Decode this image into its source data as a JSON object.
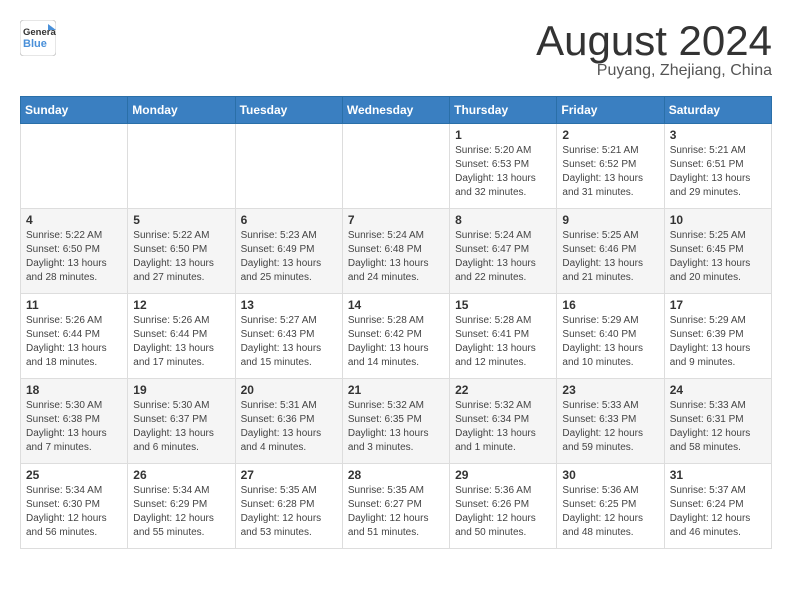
{
  "logo": {
    "line1": "General",
    "line2": "Blue"
  },
  "title": "August 2024",
  "location": "Puyang, Zhejiang, China",
  "weekdays": [
    "Sunday",
    "Monday",
    "Tuesday",
    "Wednesday",
    "Thursday",
    "Friday",
    "Saturday"
  ],
  "weeks": [
    [
      {
        "day": "",
        "info": ""
      },
      {
        "day": "",
        "info": ""
      },
      {
        "day": "",
        "info": ""
      },
      {
        "day": "",
        "info": ""
      },
      {
        "day": "1",
        "info": "Sunrise: 5:20 AM\nSunset: 6:53 PM\nDaylight: 13 hours\nand 32 minutes."
      },
      {
        "day": "2",
        "info": "Sunrise: 5:21 AM\nSunset: 6:52 PM\nDaylight: 13 hours\nand 31 minutes."
      },
      {
        "day": "3",
        "info": "Sunrise: 5:21 AM\nSunset: 6:51 PM\nDaylight: 13 hours\nand 29 minutes."
      }
    ],
    [
      {
        "day": "4",
        "info": "Sunrise: 5:22 AM\nSunset: 6:50 PM\nDaylight: 13 hours\nand 28 minutes."
      },
      {
        "day": "5",
        "info": "Sunrise: 5:22 AM\nSunset: 6:50 PM\nDaylight: 13 hours\nand 27 minutes."
      },
      {
        "day": "6",
        "info": "Sunrise: 5:23 AM\nSunset: 6:49 PM\nDaylight: 13 hours\nand 25 minutes."
      },
      {
        "day": "7",
        "info": "Sunrise: 5:24 AM\nSunset: 6:48 PM\nDaylight: 13 hours\nand 24 minutes."
      },
      {
        "day": "8",
        "info": "Sunrise: 5:24 AM\nSunset: 6:47 PM\nDaylight: 13 hours\nand 22 minutes."
      },
      {
        "day": "9",
        "info": "Sunrise: 5:25 AM\nSunset: 6:46 PM\nDaylight: 13 hours\nand 21 minutes."
      },
      {
        "day": "10",
        "info": "Sunrise: 5:25 AM\nSunset: 6:45 PM\nDaylight: 13 hours\nand 20 minutes."
      }
    ],
    [
      {
        "day": "11",
        "info": "Sunrise: 5:26 AM\nSunset: 6:44 PM\nDaylight: 13 hours\nand 18 minutes."
      },
      {
        "day": "12",
        "info": "Sunrise: 5:26 AM\nSunset: 6:44 PM\nDaylight: 13 hours\nand 17 minutes."
      },
      {
        "day": "13",
        "info": "Sunrise: 5:27 AM\nSunset: 6:43 PM\nDaylight: 13 hours\nand 15 minutes."
      },
      {
        "day": "14",
        "info": "Sunrise: 5:28 AM\nSunset: 6:42 PM\nDaylight: 13 hours\nand 14 minutes."
      },
      {
        "day": "15",
        "info": "Sunrise: 5:28 AM\nSunset: 6:41 PM\nDaylight: 13 hours\nand 12 minutes."
      },
      {
        "day": "16",
        "info": "Sunrise: 5:29 AM\nSunset: 6:40 PM\nDaylight: 13 hours\nand 10 minutes."
      },
      {
        "day": "17",
        "info": "Sunrise: 5:29 AM\nSunset: 6:39 PM\nDaylight: 13 hours\nand 9 minutes."
      }
    ],
    [
      {
        "day": "18",
        "info": "Sunrise: 5:30 AM\nSunset: 6:38 PM\nDaylight: 13 hours\nand 7 minutes."
      },
      {
        "day": "19",
        "info": "Sunrise: 5:30 AM\nSunset: 6:37 PM\nDaylight: 13 hours\nand 6 minutes."
      },
      {
        "day": "20",
        "info": "Sunrise: 5:31 AM\nSunset: 6:36 PM\nDaylight: 13 hours\nand 4 minutes."
      },
      {
        "day": "21",
        "info": "Sunrise: 5:32 AM\nSunset: 6:35 PM\nDaylight: 13 hours\nand 3 minutes."
      },
      {
        "day": "22",
        "info": "Sunrise: 5:32 AM\nSunset: 6:34 PM\nDaylight: 13 hours\nand 1 minute."
      },
      {
        "day": "23",
        "info": "Sunrise: 5:33 AM\nSunset: 6:33 PM\nDaylight: 12 hours\nand 59 minutes."
      },
      {
        "day": "24",
        "info": "Sunrise: 5:33 AM\nSunset: 6:31 PM\nDaylight: 12 hours\nand 58 minutes."
      }
    ],
    [
      {
        "day": "25",
        "info": "Sunrise: 5:34 AM\nSunset: 6:30 PM\nDaylight: 12 hours\nand 56 minutes."
      },
      {
        "day": "26",
        "info": "Sunrise: 5:34 AM\nSunset: 6:29 PM\nDaylight: 12 hours\nand 55 minutes."
      },
      {
        "day": "27",
        "info": "Sunrise: 5:35 AM\nSunset: 6:28 PM\nDaylight: 12 hours\nand 53 minutes."
      },
      {
        "day": "28",
        "info": "Sunrise: 5:35 AM\nSunset: 6:27 PM\nDaylight: 12 hours\nand 51 minutes."
      },
      {
        "day": "29",
        "info": "Sunrise: 5:36 AM\nSunset: 6:26 PM\nDaylight: 12 hours\nand 50 minutes."
      },
      {
        "day": "30",
        "info": "Sunrise: 5:36 AM\nSunset: 6:25 PM\nDaylight: 12 hours\nand 48 minutes."
      },
      {
        "day": "31",
        "info": "Sunrise: 5:37 AM\nSunset: 6:24 PM\nDaylight: 12 hours\nand 46 minutes."
      }
    ]
  ]
}
